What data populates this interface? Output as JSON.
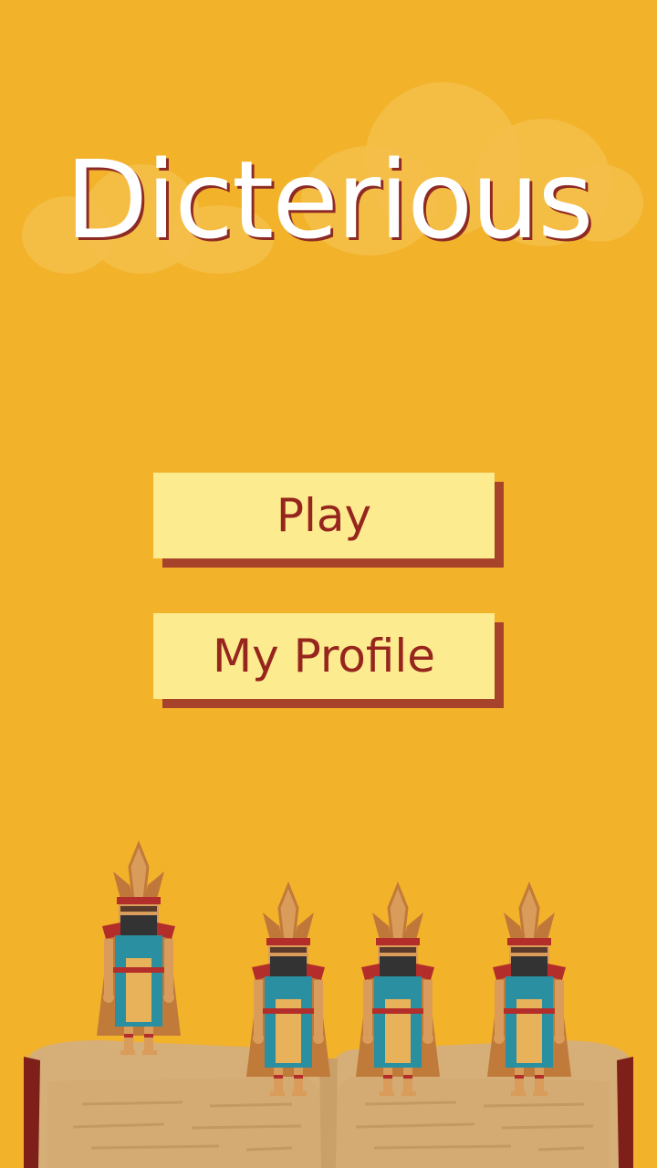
{
  "app": {
    "title": "Dicterious"
  },
  "menu": {
    "play_label": "Play",
    "profile_label": "My Profile"
  },
  "colors": {
    "background": "#F2B229",
    "button_face": "#FCEB8F",
    "button_shadow": "#A8432B",
    "button_text": "#96261D",
    "title_text": "#FFFFFF"
  },
  "icons": [
    "cloud-icon",
    "warrior-figure-icon",
    "open-book-icon"
  ]
}
